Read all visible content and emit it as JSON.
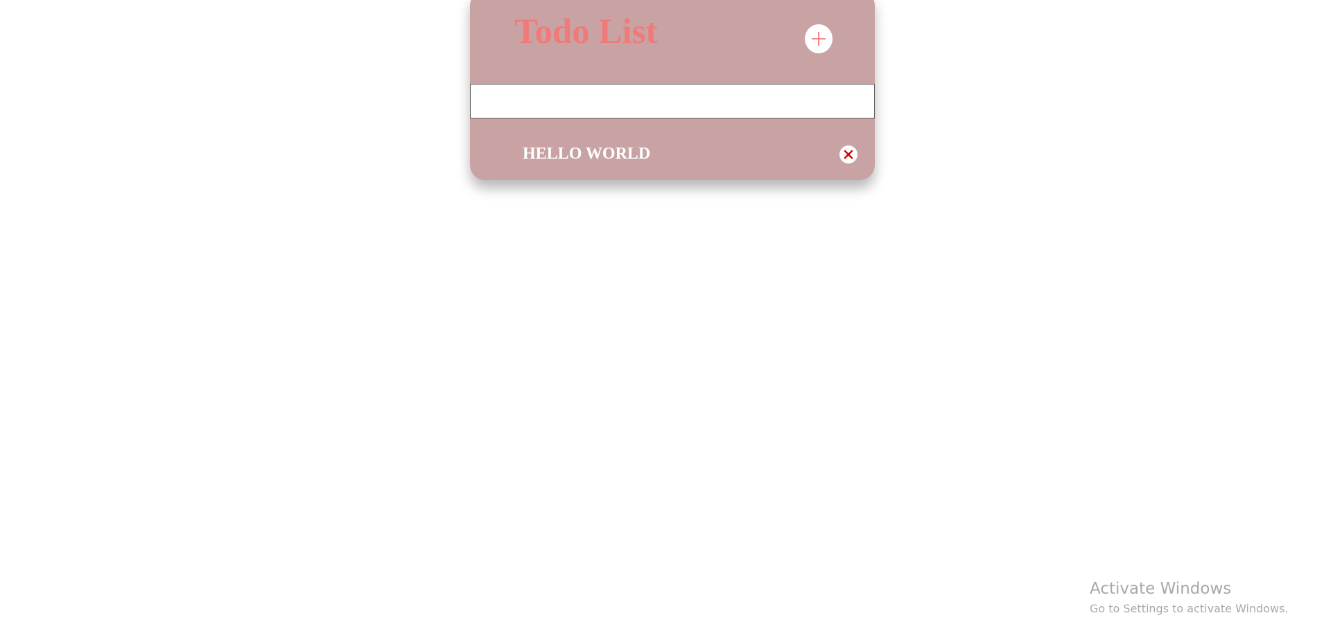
{
  "app": {
    "title": "Todo List",
    "add_icon": "plus-icon",
    "add_icon_color": "#f07a7a"
  },
  "input": {
    "value": "",
    "placeholder": ""
  },
  "todos": [
    {
      "text": "HELLO WORLD",
      "delete_icon": "close-icon",
      "delete_icon_color": "#d40000"
    }
  ],
  "colors": {
    "card_background": "#c9a3a3",
    "title_color": "#f07a7a",
    "item_text_color": "#ffffff"
  },
  "windows_notice": {
    "title": "Activate Windows",
    "subtitle": "Go to Settings to activate Windows."
  }
}
